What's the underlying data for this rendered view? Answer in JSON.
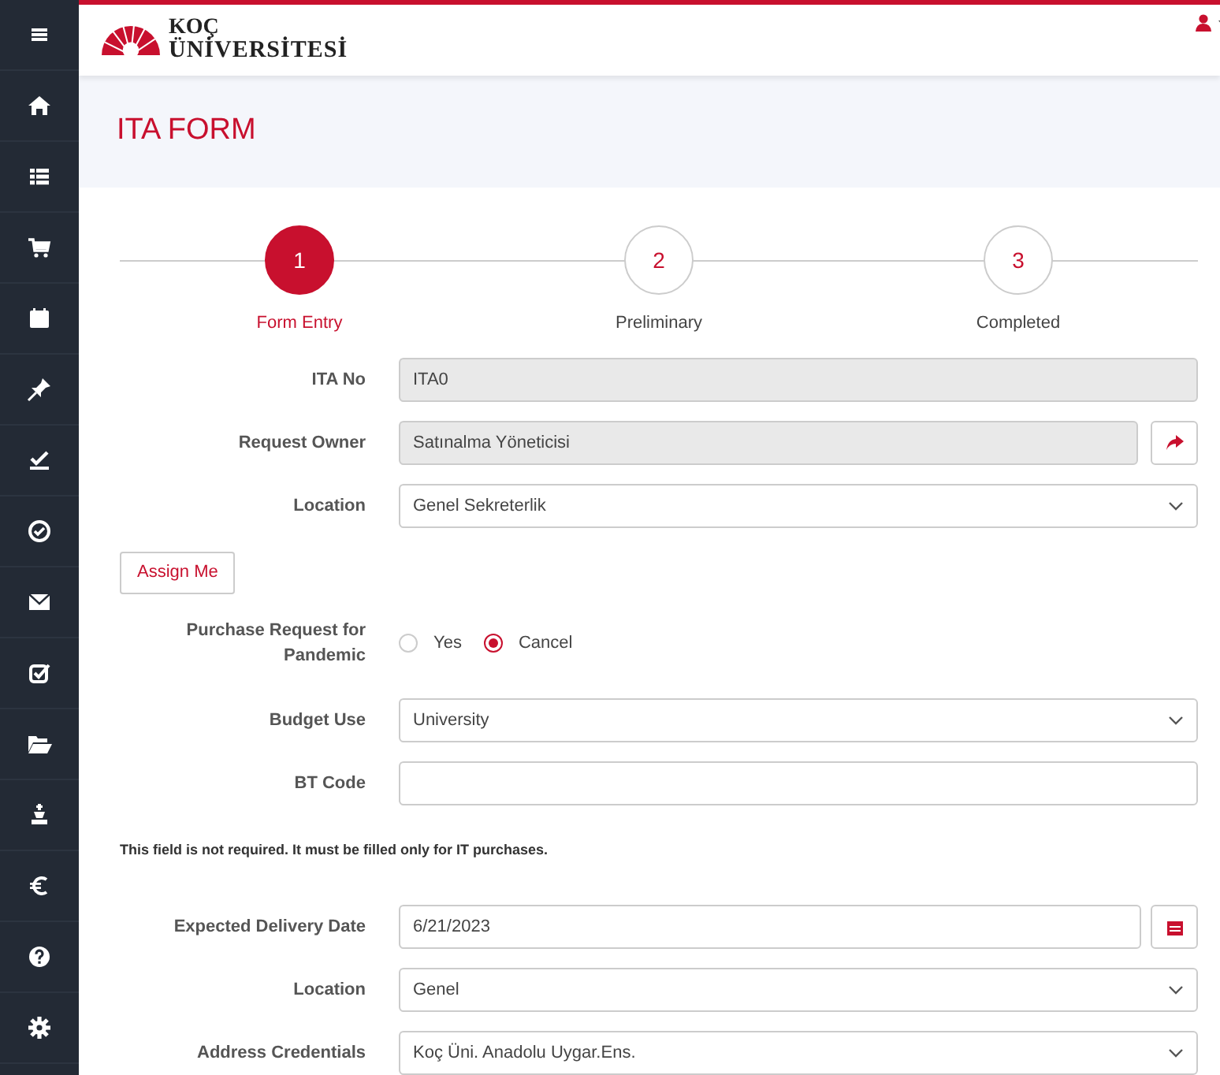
{
  "header": {
    "logo_line_1": "KOÇ",
    "logo_line_2": "ÜNİVERSİTESİ"
  },
  "page_title": "ITA FORM",
  "steps": [
    {
      "number": "1",
      "label": "Form Entry",
      "selected": true
    },
    {
      "number": "2",
      "label": "Preliminary",
      "selected": false
    },
    {
      "number": "3",
      "label": "Completed",
      "selected": false
    }
  ],
  "fields": [
    {
      "kind": "readonly",
      "label": "ITA No",
      "value": "ITA0"
    },
    {
      "kind": "readonly_action",
      "label": "Request Owner",
      "value": "Satınalma Yöneticisi"
    },
    {
      "kind": "select",
      "label": "Location",
      "value": "Genel Sekreterlik"
    },
    {
      "kind": "button",
      "text": "Assign Me"
    },
    {
      "kind": "radio",
      "label": "Purchase Request for Pandemic",
      "options": [
        {
          "label": "Yes",
          "selected": false
        },
        {
          "label": "Cancel",
          "selected": true
        }
      ]
    },
    {
      "kind": "select",
      "label": "Budget Use",
      "value": "University"
    },
    {
      "kind": "text",
      "label": "BT Code"
    },
    {
      "kind": "note",
      "text": "This field is not required. It must be filled only for IT purchases."
    },
    {
      "kind": "date",
      "label": "Expected Delivery Date",
      "value": "6/21/2023"
    },
    {
      "kind": "select",
      "label": "Location",
      "value": "Genel"
    },
    {
      "kind": "select",
      "label": "Address Credentials",
      "value": "Koç Üni. Anadolu Uygar.Ens."
    }
  ]
}
